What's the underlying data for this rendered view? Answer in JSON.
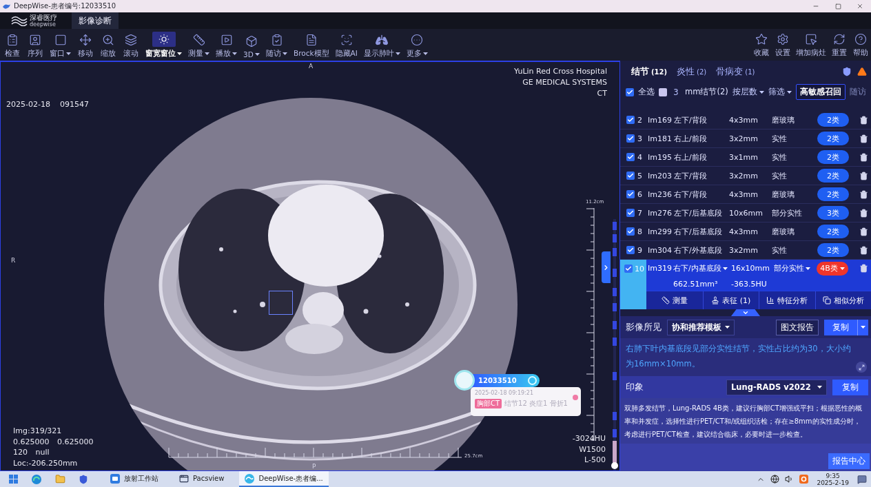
{
  "window": {
    "title": "DeepWise-患者编号:12033510"
  },
  "app_header": {
    "logo": {
      "name": "深睿医疗",
      "subtitle": "deepwise"
    },
    "tabs": [
      {
        "label": "影像诊断",
        "selected": true
      }
    ]
  },
  "toolbar": {
    "tools": [
      {
        "label": "检查",
        "dropdown": false,
        "selected": false
      },
      {
        "label": "序列",
        "dropdown": false,
        "selected": false
      },
      {
        "label": "窗口",
        "dropdown": true,
        "selected": false
      },
      {
        "label": "移动",
        "dropdown": false,
        "selected": false
      },
      {
        "label": "缩放",
        "dropdown": false,
        "selected": false
      },
      {
        "label": "滚动",
        "dropdown": false,
        "selected": false
      },
      {
        "label": "窗宽窗位",
        "dropdown": true,
        "selected": true
      },
      {
        "label": "测量",
        "dropdown": true,
        "selected": false
      },
      {
        "label": "播放",
        "dropdown": true,
        "selected": false
      },
      {
        "label": "3D",
        "dropdown": true,
        "selected": false
      },
      {
        "label": "随访",
        "dropdown": true,
        "selected": false
      },
      {
        "label": "Brock模型",
        "dropdown": false,
        "selected": false
      },
      {
        "label": "隐藏AI",
        "dropdown": false,
        "selected": false
      },
      {
        "label": "显示肺叶",
        "dropdown": true,
        "selected": false
      },
      {
        "label": "更多",
        "dropdown": true,
        "selected": false
      }
    ],
    "actions": [
      "收藏",
      "设置",
      "增加病灶",
      "重置",
      "帮助"
    ]
  },
  "viewport": {
    "orientation": {
      "top": "A",
      "left": "R",
      "bottom": "P"
    },
    "study_date": "2025-02-18",
    "study_time": "091547",
    "institution": [
      "YuLin Red Cross Hospital",
      "GE MEDICAL SYSTEMS",
      "CT"
    ],
    "vertical_scale": "11.2cm",
    "horizontal_scale": "25.7cm",
    "image_info": [
      "Img:319/321",
      "0.625000 0.625000",
      "120 null",
      "Loc:-206.250mm"
    ],
    "window_info": [
      "-3024HU",
      "W1500",
      "L-500"
    ],
    "patient_card": {
      "id": "12033510",
      "datetime": "2025-02-18 09:19:21",
      "tag": "胸部CT",
      "summary": "结节12 炎症1 骨折1"
    }
  },
  "findings_panel": {
    "tabs": [
      {
        "label": "结节",
        "count": "(12)",
        "selected": true
      },
      {
        "label": "炎性",
        "count": "(2)",
        "selected": false
      },
      {
        "label": "骨病变",
        "count": "(1)",
        "selected": false
      }
    ],
    "filters": {
      "select_all": {
        "label": "全选",
        "checked": true
      },
      "size_filter": {
        "checked": false,
        "value": "3",
        "label": "mm结节(2)"
      },
      "sort": "按层数",
      "filter": "筛选",
      "recall_button": "高敏感召回",
      "followup": "随访"
    },
    "nodules": [
      {
        "index": "2",
        "image": "Im169",
        "location": "左下/背段",
        "size": "4x3mm",
        "type": "磨玻璃",
        "category": "2类",
        "color": "#1f5ff2",
        "checked": true,
        "selected": false
      },
      {
        "index": "3",
        "image": "Im181",
        "location": "右上/前段",
        "size": "3x2mm",
        "type": "实性",
        "category": "2类",
        "color": "#1f5ff2",
        "checked": true,
        "selected": false
      },
      {
        "index": "4",
        "image": "Im195",
        "location": "右上/前段",
        "size": "3x1mm",
        "type": "实性",
        "category": "2类",
        "color": "#1f5ff2",
        "checked": true,
        "selected": false
      },
      {
        "index": "5",
        "image": "Im203",
        "location": "左下/背段",
        "size": "3x2mm",
        "type": "实性",
        "category": "2类",
        "color": "#1f5ff2",
        "checked": true,
        "selected": false
      },
      {
        "index": "6",
        "image": "Im236",
        "location": "右下/背段",
        "size": "4x3mm",
        "type": "磨玻璃",
        "category": "2类",
        "color": "#1f5ff2",
        "checked": true,
        "selected": false
      },
      {
        "index": "7",
        "image": "Im276",
        "location": "左下/后基底段",
        "size": "10x6mm",
        "type": "部分实性",
        "category": "3类",
        "color": "#1f5ff2",
        "checked": true,
        "selected": false
      },
      {
        "index": "8",
        "image": "Im299",
        "location": "右下/后基底段",
        "size": "4x3mm",
        "type": "磨玻璃",
        "category": "2类",
        "color": "#1f5ff2",
        "checked": true,
        "selected": false
      },
      {
        "index": "9",
        "image": "Im304",
        "location": "右下/外基底段",
        "size": "3x2mm",
        "type": "实性",
        "category": "2类",
        "color": "#1f5ff2",
        "checked": true,
        "selected": false
      },
      {
        "index": "10",
        "image": "Im319",
        "location": "右下/内基底段",
        "size": "16x10mm",
        "type": "部分实性",
        "category": "4B类",
        "color": "#f0352b",
        "checked": true,
        "selected": true,
        "volume": "662.51mm³",
        "density": "-363.5HU"
      }
    ],
    "detail_actions": [
      "测量",
      "表征 (1)",
      "特征分析",
      "相似分析"
    ],
    "findings": {
      "label": "影像所见",
      "template": "协和推荐模板",
      "report_button": "图文报告",
      "copy_button": "复制",
      "text": "右肺下叶内基底段见部分实性结节，实性占比约为30，大小约为16mm×10mm。"
    },
    "impression": {
      "label": "印象",
      "template": "Lung-RADS v2022",
      "copy_button": "复制",
      "text": "双肺多发结节，Lung-RADS 4B类，建议行胸部CT增强或平扫；根据恶性的概率和并发症，选择性进行PET/CT和/或组织活检；存在≥8mm的实性成分时，考虑进行PET/CT检查，建议结合临床，必要时进一步检查。"
    },
    "report_center_button": "报告中心"
  },
  "taskbar": {
    "apps": [
      {
        "label": "放射工作站",
        "selected": false
      },
      {
        "label": "Pacsview",
        "selected": false
      },
      {
        "label": "DeepWise-患者编...",
        "selected": true
      }
    ],
    "time": "9:35",
    "date": "2025-2-19"
  }
}
